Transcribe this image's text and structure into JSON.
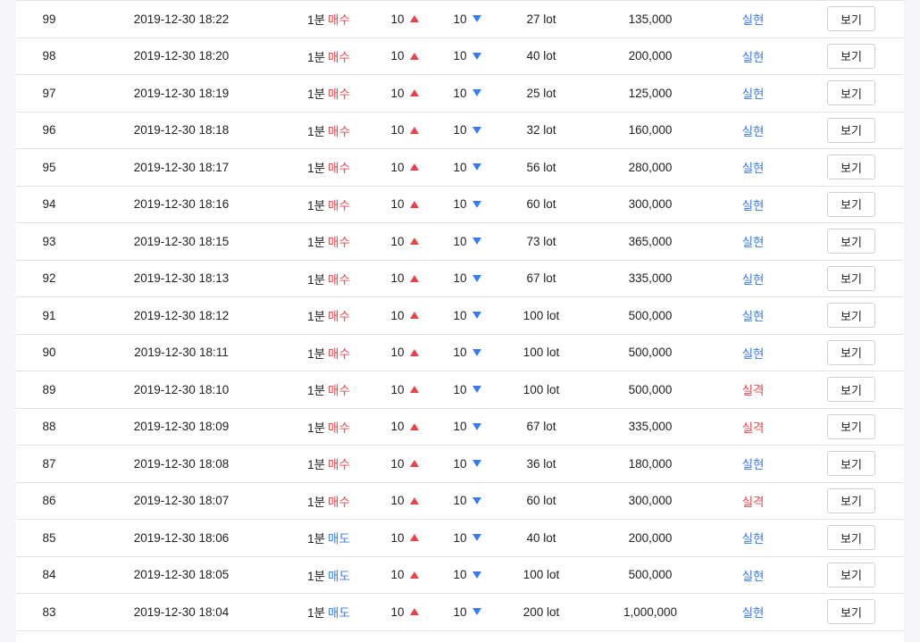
{
  "colors": {
    "buy": "#e8444b",
    "sell": "#3a7bea",
    "result_ok": "#3a7bea",
    "result_fail": "#e8444b"
  },
  "icons": {
    "up": "triangle-up-icon",
    "down": "triangle-down-icon"
  },
  "rows": [
    {
      "no": "99",
      "datetime": "2019-12-30 18:22",
      "interval": "1분",
      "side": "매수",
      "side_type": "buy",
      "up": "10",
      "down": "10",
      "lot": "27 lot",
      "amount": "135,000",
      "result": "실현",
      "result_type": "ok",
      "action": "보기"
    },
    {
      "no": "98",
      "datetime": "2019-12-30 18:20",
      "interval": "1분",
      "side": "매수",
      "side_type": "buy",
      "up": "10",
      "down": "10",
      "lot": "40 lot",
      "amount": "200,000",
      "result": "실현",
      "result_type": "ok",
      "action": "보기"
    },
    {
      "no": "97",
      "datetime": "2019-12-30 18:19",
      "interval": "1분",
      "side": "매수",
      "side_type": "buy",
      "up": "10",
      "down": "10",
      "lot": "25 lot",
      "amount": "125,000",
      "result": "실현",
      "result_type": "ok",
      "action": "보기"
    },
    {
      "no": "96",
      "datetime": "2019-12-30 18:18",
      "interval": "1분",
      "side": "매수",
      "side_type": "buy",
      "up": "10",
      "down": "10",
      "lot": "32 lot",
      "amount": "160,000",
      "result": "실현",
      "result_type": "ok",
      "action": "보기"
    },
    {
      "no": "95",
      "datetime": "2019-12-30 18:17",
      "interval": "1분",
      "side": "매수",
      "side_type": "buy",
      "up": "10",
      "down": "10",
      "lot": "56 lot",
      "amount": "280,000",
      "result": "실현",
      "result_type": "ok",
      "action": "보기"
    },
    {
      "no": "94",
      "datetime": "2019-12-30 18:16",
      "interval": "1분",
      "side": "매수",
      "side_type": "buy",
      "up": "10",
      "down": "10",
      "lot": "60 lot",
      "amount": "300,000",
      "result": "실현",
      "result_type": "ok",
      "action": "보기"
    },
    {
      "no": "93",
      "datetime": "2019-12-30 18:15",
      "interval": "1분",
      "side": "매수",
      "side_type": "buy",
      "up": "10",
      "down": "10",
      "lot": "73 lot",
      "amount": "365,000",
      "result": "실현",
      "result_type": "ok",
      "action": "보기"
    },
    {
      "no": "92",
      "datetime": "2019-12-30 18:13",
      "interval": "1분",
      "side": "매수",
      "side_type": "buy",
      "up": "10",
      "down": "10",
      "lot": "67 lot",
      "amount": "335,000",
      "result": "실현",
      "result_type": "ok",
      "action": "보기"
    },
    {
      "no": "91",
      "datetime": "2019-12-30 18:12",
      "interval": "1분",
      "side": "매수",
      "side_type": "buy",
      "up": "10",
      "down": "10",
      "lot": "100 lot",
      "amount": "500,000",
      "result": "실현",
      "result_type": "ok",
      "action": "보기"
    },
    {
      "no": "90",
      "datetime": "2019-12-30 18:11",
      "interval": "1분",
      "side": "매수",
      "side_type": "buy",
      "up": "10",
      "down": "10",
      "lot": "100 lot",
      "amount": "500,000",
      "result": "실현",
      "result_type": "ok",
      "action": "보기"
    },
    {
      "no": "89",
      "datetime": "2019-12-30 18:10",
      "interval": "1분",
      "side": "매수",
      "side_type": "buy",
      "up": "10",
      "down": "10",
      "lot": "100 lot",
      "amount": "500,000",
      "result": "실격",
      "result_type": "fail",
      "action": "보기"
    },
    {
      "no": "88",
      "datetime": "2019-12-30 18:09",
      "interval": "1분",
      "side": "매수",
      "side_type": "buy",
      "up": "10",
      "down": "10",
      "lot": "67 lot",
      "amount": "335,000",
      "result": "실격",
      "result_type": "fail",
      "action": "보기"
    },
    {
      "no": "87",
      "datetime": "2019-12-30 18:08",
      "interval": "1분",
      "side": "매수",
      "side_type": "buy",
      "up": "10",
      "down": "10",
      "lot": "36 lot",
      "amount": "180,000",
      "result": "실현",
      "result_type": "ok",
      "action": "보기"
    },
    {
      "no": "86",
      "datetime": "2019-12-30 18:07",
      "interval": "1분",
      "side": "매수",
      "side_type": "buy",
      "up": "10",
      "down": "10",
      "lot": "60 lot",
      "amount": "300,000",
      "result": "실격",
      "result_type": "fail",
      "action": "보기"
    },
    {
      "no": "85",
      "datetime": "2019-12-30 18:06",
      "interval": "1분",
      "side": "매도",
      "side_type": "sell",
      "up": "10",
      "down": "10",
      "lot": "40 lot",
      "amount": "200,000",
      "result": "실현",
      "result_type": "ok",
      "action": "보기"
    },
    {
      "no": "84",
      "datetime": "2019-12-30 18:05",
      "interval": "1분",
      "side": "매도",
      "side_type": "sell",
      "up": "10",
      "down": "10",
      "lot": "100 lot",
      "amount": "500,000",
      "result": "실현",
      "result_type": "ok",
      "action": "보기"
    },
    {
      "no": "83",
      "datetime": "2019-12-30 18:04",
      "interval": "1분",
      "side": "매도",
      "side_type": "sell",
      "up": "10",
      "down": "10",
      "lot": "200 lot",
      "amount": "1,000,000",
      "result": "실현",
      "result_type": "ok",
      "action": "보기"
    }
  ]
}
